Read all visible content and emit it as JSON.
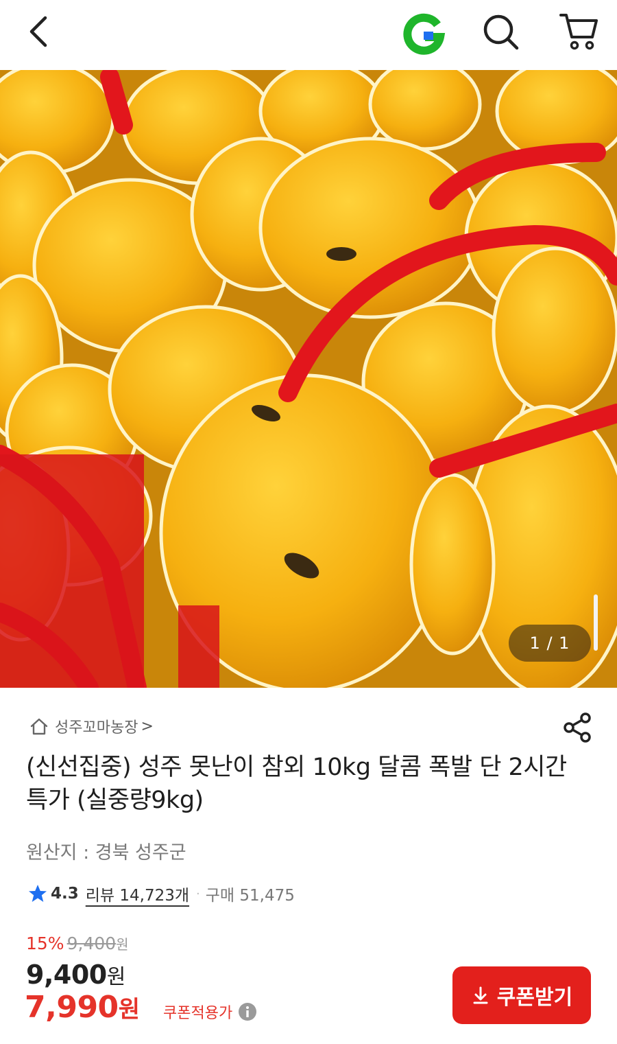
{
  "header": {
    "back_icon": "chevron-left-icon",
    "brand_icon": "gmarket-g-logo",
    "search_icon": "search-icon",
    "cart_icon": "cart-icon"
  },
  "gallery": {
    "counter": "1 / 1",
    "image_description_icon": "product-photo"
  },
  "seller": {
    "icon": "home-icon",
    "name": "성주꼬마농장",
    "chevron": ">"
  },
  "share_icon": "share-icon",
  "product": {
    "title": "(신선집중) 성주 못난이 참외 10kg 달콤 폭발 단 2시간 특가 (실중량9kg)",
    "origin": "원산지 : 경북 성주군"
  },
  "rating": {
    "score": "4.3",
    "review_label": "리뷰 14,723개",
    "separator": "·",
    "purchase_label": "구매 51,475"
  },
  "price": {
    "discount_rate": "15%",
    "original": "9,400",
    "original_unit": "원",
    "current": "9,400",
    "current_unit": "원",
    "coupon_price": "7,990",
    "coupon_unit": "원",
    "coupon_note": "쿠폰적용가"
  },
  "coupon_button": {
    "label": "쿠폰받기",
    "icon": "download-icon"
  },
  "colors": {
    "accent_red": "#e3201c",
    "price_red": "#e5332a",
    "brand_green": "#1fb52b",
    "brand_blue": "#1e6ff0"
  }
}
